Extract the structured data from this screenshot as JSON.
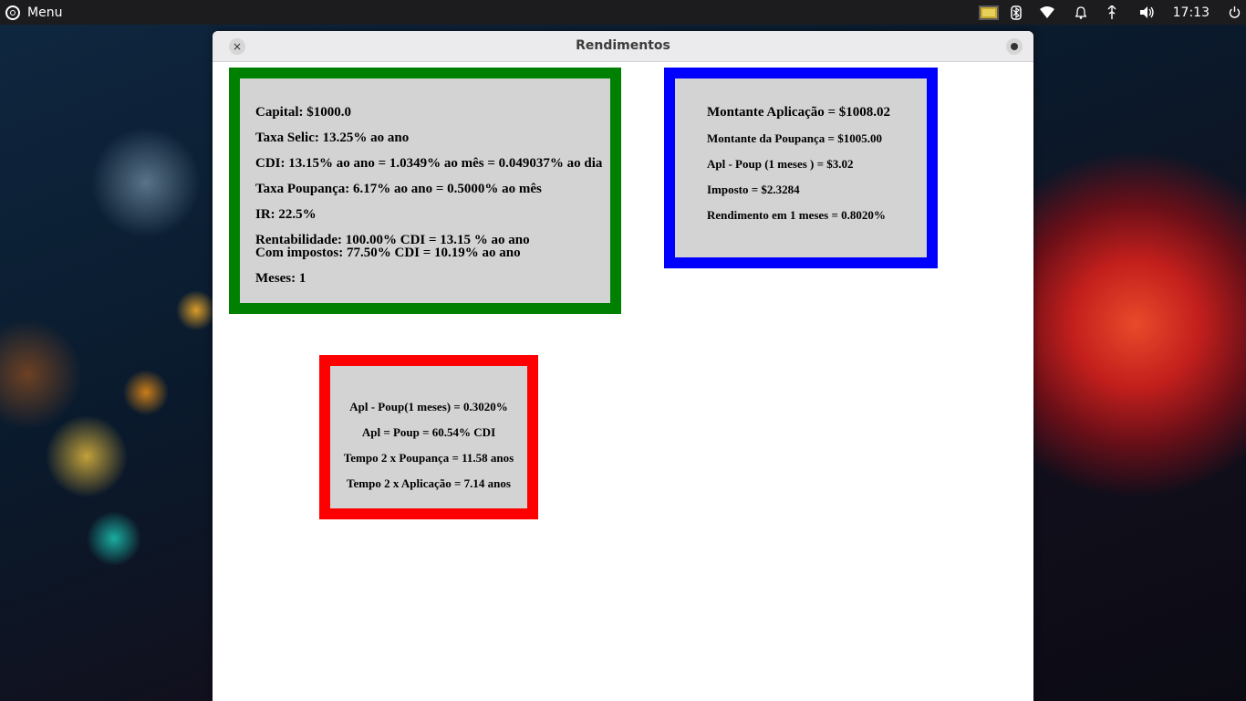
{
  "top_panel": {
    "menu_label": "Menu",
    "clock": "17:13"
  },
  "window": {
    "title": "Rendimentos",
    "close_glyph": "×"
  },
  "params_panel": {
    "capital": "Capital: $1000.0",
    "selic": "Taxa Selic: 13.25% ao ano",
    "cdi": "CDI: 13.15% ao ano = 1.0349% ao mês = 0.049037% ao dia",
    "poupanca": "Taxa Poupança: 6.17% ao ano = 0.5000% ao mês",
    "ir": "IR: 22.5%",
    "rentabilidade": "Rentabilidade:  100.00% CDI = 13.15 % ao ano",
    "com_impostos": "Com impostos:  77.50% CDI = 10.19% ao ano",
    "meses": "Meses: 1"
  },
  "results_panel": {
    "montante_aplicacao": "Montante Aplicação = $1008.02",
    "montante_poupanca": "Montante da Poupança = $1005.00",
    "apl_poup": "Apl - Poup (1 meses ) = $3.02",
    "imposto": "Imposto = $2.3284",
    "rendimento": "Rendimento em 1 meses = 0.8020%"
  },
  "compare_panel": {
    "apl_poup_pct": "Apl - Poup(1 meses) = 0.3020%",
    "apl_eq_poup": "Apl = Poup = 60.54% CDI",
    "tempo_poupanca": "Tempo 2 x Poupança = 11.58 anos",
    "tempo_aplicacao": "Tempo 2 x Aplicação = 7.14 anos"
  },
  "colors": {
    "params_border": "#008000",
    "results_border": "#0000ff",
    "compare_border": "#ff0000",
    "panel_bg": "#d3d3d3"
  },
  "icons": [
    "ubuntu-logo-icon",
    "display-icon",
    "bluetooth-icon",
    "wifi-icon",
    "bell-icon",
    "network-icon",
    "volume-icon",
    "power-icon"
  ]
}
